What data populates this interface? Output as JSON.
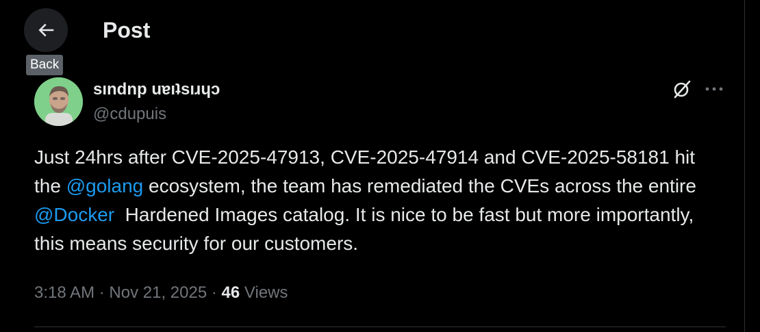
{
  "header": {
    "title": "Post",
    "back_tooltip": "Back",
    "back_icon": "arrow-left-icon"
  },
  "author": {
    "display_name": "sındnp uɐıʇsıɹɥɔ",
    "handle": "@cdupuis",
    "avatar_icon": "avatar",
    "avatar_bg": "#7fd08a"
  },
  "post": {
    "text_segments": [
      {
        "text": "Just 24hrs after CVE-2025-47913, CVE-2025-47914 and CVE-2025-58181 hit the ",
        "type": "text"
      },
      {
        "text": "@golang",
        "type": "mention"
      },
      {
        "text": " ecosystem, the team has remediated the CVEs across the entire ",
        "type": "text"
      },
      {
        "text": "@Docker",
        "type": "mention"
      },
      {
        "text": "  Hardened Images catalog. It is nice to be fast but more importantly, this means security for our customers.",
        "type": "text"
      }
    ],
    "time": "3:18 AM",
    "separator": "·",
    "date": "Nov 21, 2025",
    "views_count": "46",
    "views_label": "Views"
  },
  "actions": {
    "grok_icon": "grok-icon",
    "more_icon": "more-horizontal-icon"
  },
  "colors": {
    "background": "#000000",
    "text_primary": "#e7e9ea",
    "text_secondary": "#71767b",
    "accent": "#1d9bf0",
    "border": "#2f3336"
  }
}
